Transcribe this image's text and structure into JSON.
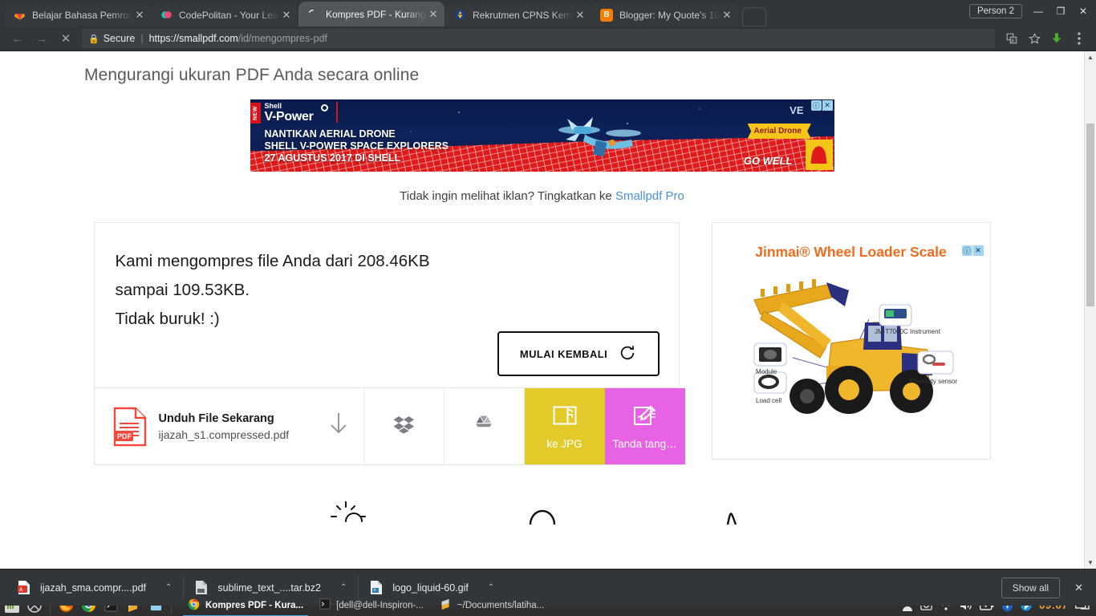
{
  "browser": {
    "tabs": [
      {
        "title": "Belajar Bahasa Pemrog",
        "favicon": "gitlab-icon",
        "active": false
      },
      {
        "title": "CodePolitan - Your Lear",
        "favicon": "codepolitan-icon",
        "active": false
      },
      {
        "title": "Kompres PDF - Kurangi",
        "favicon": "loading-spinner-icon",
        "active": true
      },
      {
        "title": "Rekrutmen CPNS Keme",
        "favicon": "garuda-icon",
        "active": false
      },
      {
        "title": "Blogger: My Quote's 10",
        "favicon": "blogger-icon",
        "active": false
      }
    ],
    "tab_close_label": "✕",
    "profile_label": "Person 2",
    "window_controls": {
      "minimize": "—",
      "maximize": "❐",
      "close": "✕"
    },
    "toolbar": {
      "back": "←",
      "forward": "→",
      "stop": "✕",
      "security_label": "Secure",
      "url_scheme": "https://",
      "url_host": "smallpdf.com",
      "url_path": "/id/mengompres-pdf",
      "icons": [
        "translate-icon",
        "bookmark-star-icon",
        "downloads-icon",
        "chrome-menu-icon"
      ]
    }
  },
  "page": {
    "heading": "Mengurangi ukuran PDF Anda secara online",
    "banner_ad": {
      "new_flag": "NEW",
      "brand_line1": "Shell",
      "brand_line2": "V-Power",
      "headline_line1": "NANTIKAN AERIAL DRONE",
      "headline_line2": "SHELL V-POWER SPACE EXPLORERS",
      "headline_line3": "27 AGUSTUS 2017 DI SHELL",
      "chip": "Aerial Drone",
      "tagline": "GO WELL",
      "advertiser": "VE",
      "adchoices_info": "ⓘ",
      "adchoices_close": "✕"
    },
    "ad_note": {
      "text": "Tidak ingin melihat iklan? Tingkatkan ke ",
      "link": "Smallpdf Pro",
      "link_color": "#4a90e2"
    },
    "result_card": {
      "line1": "Kami mengompres file Anda dari 208.46KB",
      "line2": "sampai 109.53KB.",
      "line3": "Tidak buruk! :)",
      "original_size": "208.46KB",
      "compressed_size": "109.53KB",
      "restart_button": "MULAI KEMBALI",
      "restart_icon": "refresh-icon"
    },
    "download_bar": {
      "title": "Unduh File Sekarang",
      "filename": "ijazah_s1.compressed.pdf",
      "file_type_badge": "PDF",
      "download_icon": "down-arrow-icon",
      "dropbox_icon": "dropbox-icon",
      "gdrive_icon": "google-drive-icon",
      "to_jpg_label": "ke JPG",
      "to_jpg_color": "#e2ca2b",
      "sign_label": "Tanda tang…",
      "sign_color": "#e863e3"
    },
    "side_ad": {
      "title": "Jinmai® Wheel Loader Scale",
      "labels": [
        "JM-T7000C Instrument",
        "Module",
        "Load cell",
        "Proximity sensor"
      ],
      "adchoices_info": "ⓘ",
      "adchoices_close": "✕",
      "title_color": "#f26a1b"
    },
    "scrollbar": {
      "up": "▲",
      "down": "▼"
    }
  },
  "download_shelf": {
    "items": [
      {
        "name": "ijazah_sma.compr....pdf",
        "icon": "pdf-file-icon",
        "caret": "⌃"
      },
      {
        "name": "sublime_text_....tar.bz2",
        "icon": "archive-file-icon",
        "caret": "⌃"
      },
      {
        "name": "logo_liquid-60.gif",
        "icon": "image-file-icon",
        "caret": "⌃"
      }
    ],
    "show_all": "Show all",
    "close": "✕"
  },
  "taskbar": {
    "launchers": [
      "mint-menu-icon",
      "show-desktop-icon",
      "firefox-icon",
      "chrome-icon",
      "terminal-icon",
      "sublime-text-icon",
      "files-icon"
    ],
    "windows": [
      {
        "title": "Kompres PDF - Kura...",
        "icon": "chrome-icon",
        "active": true
      },
      {
        "title": "[dell@dell-Inspiron-...",
        "icon": "terminal-icon",
        "active": false
      },
      {
        "title": "~/Documents/latiha...",
        "icon": "sublime-text-icon",
        "active": false
      }
    ],
    "tray": [
      "user-icon",
      "removable-drive-icon",
      "wifi-icon",
      "volume-icon",
      "battery-icon",
      "shield-icon",
      "bluetooth-icon"
    ],
    "clock": "09:07",
    "workspace_icon": "workspace-switcher-icon",
    "clock_color": "#e8a33d"
  }
}
